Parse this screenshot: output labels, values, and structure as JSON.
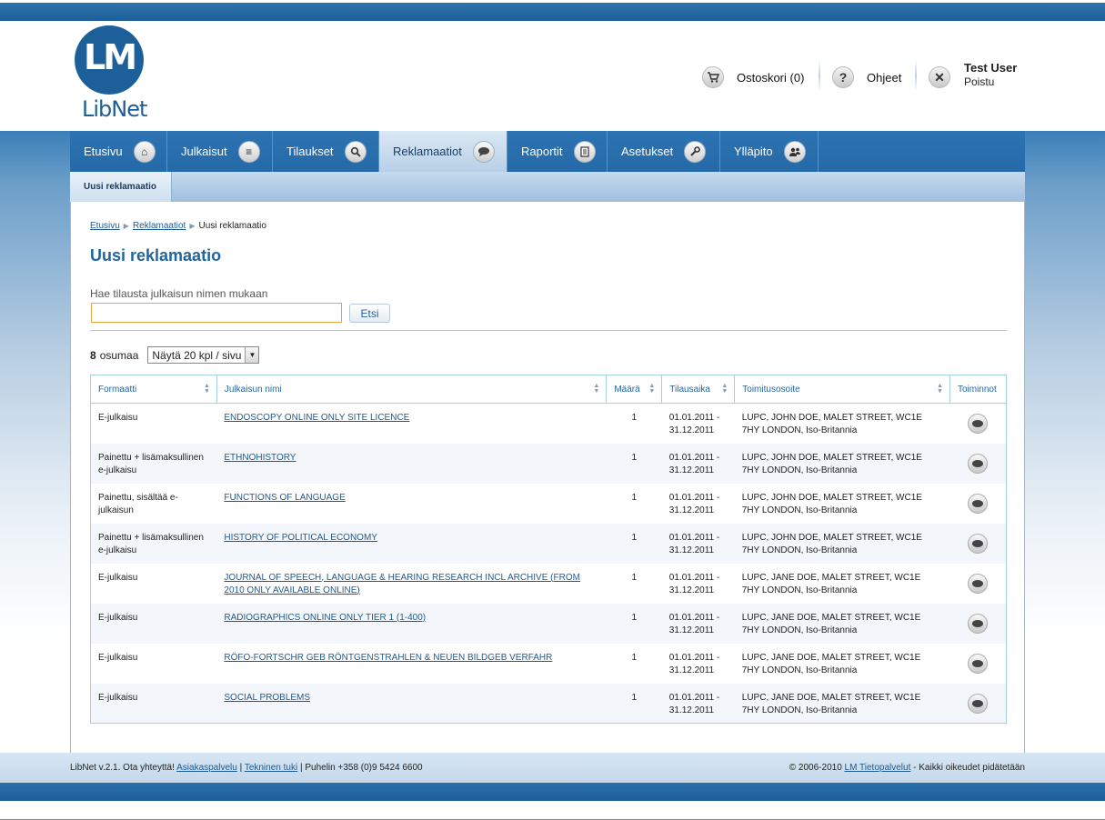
{
  "brand": {
    "logo_mark": "LM",
    "logo_text": "LibNet"
  },
  "header": {
    "cart_label": "Ostoskori (0)",
    "help_label": "Ohjeet",
    "user_name": "Test User",
    "logout_label": "Poistu"
  },
  "nav": {
    "items": [
      {
        "label": "Etusivu",
        "icon": "home-icon"
      },
      {
        "label": "Julkaisut",
        "icon": "stack-icon"
      },
      {
        "label": "Tilaukset",
        "icon": "magnifier-icon"
      },
      {
        "label": "Reklamaatiot",
        "icon": "speech-bubble-icon"
      },
      {
        "label": "Raportit",
        "icon": "document-icon"
      },
      {
        "label": "Asetukset",
        "icon": "wrench-icon"
      },
      {
        "label": "Ylläpito",
        "icon": "users-icon"
      }
    ],
    "active": "Reklamaatiot"
  },
  "subnav": {
    "item": "Uusi reklamaatio"
  },
  "breadcrumb": [
    "Etusivu",
    "Reklamaatiot",
    "Uusi reklamaatio"
  ],
  "page": {
    "title": "Uusi reklamaatio"
  },
  "search": {
    "label": "Hae tilausta julkaisun nimen mukaan",
    "value": "",
    "button_label": "Etsi"
  },
  "results": {
    "count": "8",
    "count_label": "osumaa",
    "per_page_selected": "Näytä 20 kpl / sivu"
  },
  "table": {
    "headers": [
      "Formaatti",
      "Julkaisun nimi",
      "Määrä",
      "Tilausaika",
      "Toimitusosoite",
      "Toiminnot"
    ],
    "rows": [
      {
        "format": "E-julkaisu",
        "name": "ENDOSCOPY ONLINE ONLY SITE LICENCE",
        "qty": "1",
        "period_start": "01.01.2011 -",
        "period_end": "31.12.2011",
        "addr1": "LUPC, JOHN DOE, MALET STREET, WC1E",
        "addr2": "7HY LONDON, Iso-Britannia"
      },
      {
        "format": "Painettu + lisämaksullinen e-julkaisu",
        "name": "ETHNOHISTORY",
        "qty": "1",
        "period_start": "01.01.2011 -",
        "period_end": "31.12.2011",
        "addr1": "LUPC, JOHN DOE, MALET STREET, WC1E",
        "addr2": "7HY LONDON, Iso-Britannia"
      },
      {
        "format": "Painettu, sisältää e-julkaisun",
        "name": "FUNCTIONS OF LANGUAGE",
        "qty": "1",
        "period_start": "01.01.2011 -",
        "period_end": "31.12.2011",
        "addr1": "LUPC, JOHN DOE, MALET STREET, WC1E",
        "addr2": "7HY LONDON, Iso-Britannia"
      },
      {
        "format": "Painettu + lisämaksullinen e-julkaisu",
        "name": "HISTORY OF POLITICAL ECONOMY",
        "qty": "1",
        "period_start": "01.01.2011 -",
        "period_end": "31.12.2011",
        "addr1": "LUPC, JOHN DOE, MALET STREET, WC1E",
        "addr2": "7HY LONDON, Iso-Britannia"
      },
      {
        "format": "E-julkaisu",
        "name": "JOURNAL OF SPEECH, LANGUAGE & HEARING RESEARCH INCL ARCHIVE (FROM 2010 ONLY AVAILABLE ONLINE)",
        "qty": "1",
        "period_start": "01.01.2011 -",
        "period_end": "31.12.2011",
        "addr1": "LUPC, JANE DOE, MALET STREET, WC1E",
        "addr2": "7HY LONDON, Iso-Britannia"
      },
      {
        "format": "E-julkaisu",
        "name": "RADIOGRAPHICS ONLINE ONLY TIER 1 (1-400)",
        "qty": "1",
        "period_start": "01.01.2011 -",
        "period_end": "31.12.2011",
        "addr1": "LUPC, JANE DOE, MALET STREET, WC1E",
        "addr2": "7HY LONDON, Iso-Britannia"
      },
      {
        "format": "E-julkaisu",
        "name": "RÖFO-FORTSCHR GEB RÖNTGENSTRAHLEN & NEUEN BILDGEB VERFAHR",
        "qty": "1",
        "period_start": "01.01.2011 -",
        "period_end": "31.12.2011",
        "addr1": "LUPC, JANE DOE, MALET STREET, WC1E",
        "addr2": "7HY LONDON, Iso-Britannia"
      },
      {
        "format": "E-julkaisu",
        "name": "SOCIAL PROBLEMS",
        "qty": "1",
        "period_start": "01.01.2011 -",
        "period_end": "31.12.2011",
        "addr1": "LUPC, JANE DOE, MALET STREET, WC1E",
        "addr2": "7HY LONDON, Iso-Britannia"
      }
    ]
  },
  "footer": {
    "version_text": "LibNet v.2.1. Ota yhteyttä!",
    "link_customer": "Asiakaspalvelu",
    "link_support": "Tekninen tuki",
    "phone_text": "Puhelin +358 (0)9 5424 6600",
    "copyright_text": "© 2006-2010",
    "link_company": "LM Tietopalvelut",
    "rights_text": "- Kaikki oikeudet pidätetään"
  },
  "colors": {
    "brand_blue": "#1d5f99",
    "nav_blue": "#2e73b1",
    "link_blue": "#1f5a8f",
    "input_focus": "#e6a544"
  }
}
